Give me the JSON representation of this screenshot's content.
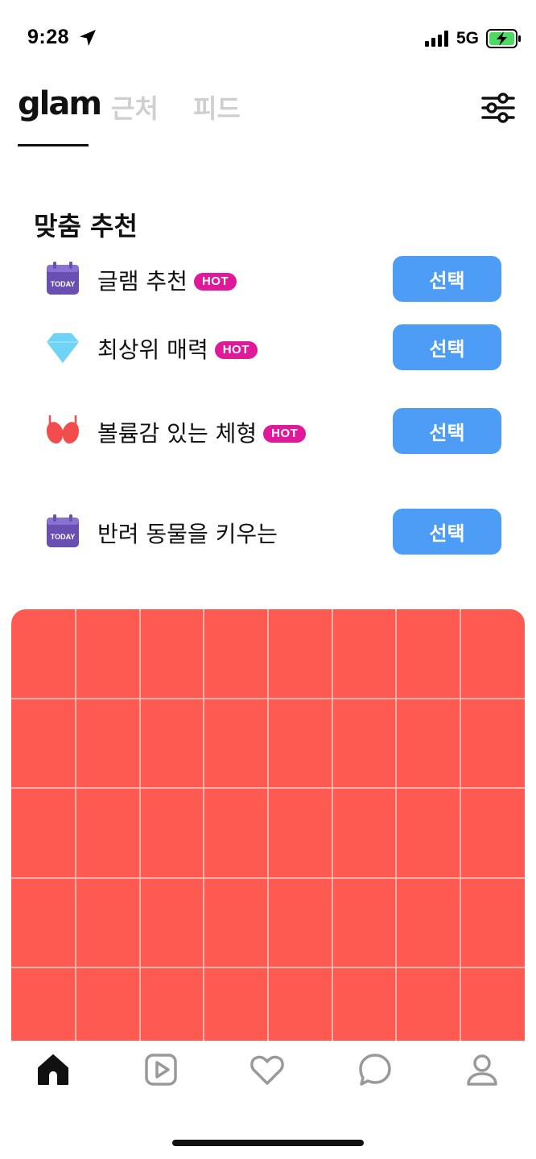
{
  "status_bar": {
    "time": "9:28",
    "network": "5G",
    "icons": [
      "location-arrow-icon",
      "signal-bars-icon",
      "battery-charging-icon"
    ]
  },
  "header": {
    "logo": "glam",
    "tabs": [
      {
        "label": "근처",
        "active": false
      },
      {
        "label": "피드",
        "active": false
      }
    ],
    "active_tab": "glam",
    "filter_icon": "sliders-icon"
  },
  "section": {
    "title": "맞춤 추천"
  },
  "recommendations": [
    {
      "label": "글램 추천",
      "hot": "HOT",
      "button": "선택",
      "icon": "today-calendar-icon",
      "icon_text": "TODAY"
    },
    {
      "label": "최상위 매력",
      "hot": "HOT",
      "button": "선택",
      "icon": "diamond-icon"
    },
    {
      "label": "볼륨감 있는 체형",
      "hot": "HOT",
      "button": "선택",
      "icon": "bra-icon"
    },
    {
      "label": "반려 동물을 키우는",
      "hot": "",
      "button": "선택",
      "icon": "today-calendar-icon",
      "icon_text": "TODAY"
    }
  ],
  "bottom_nav": {
    "items": [
      "home-icon",
      "play-icon",
      "heart-icon",
      "chat-icon",
      "profile-icon"
    ],
    "active": "home-icon"
  },
  "colors": {
    "accent_button": "#4d9df6",
    "hot_badge": "#e0189a",
    "grid_card": "#ff5a51",
    "calendar": "#6a4fb3",
    "diamond": "#6fd3f5",
    "bra": "#f24d4d"
  }
}
